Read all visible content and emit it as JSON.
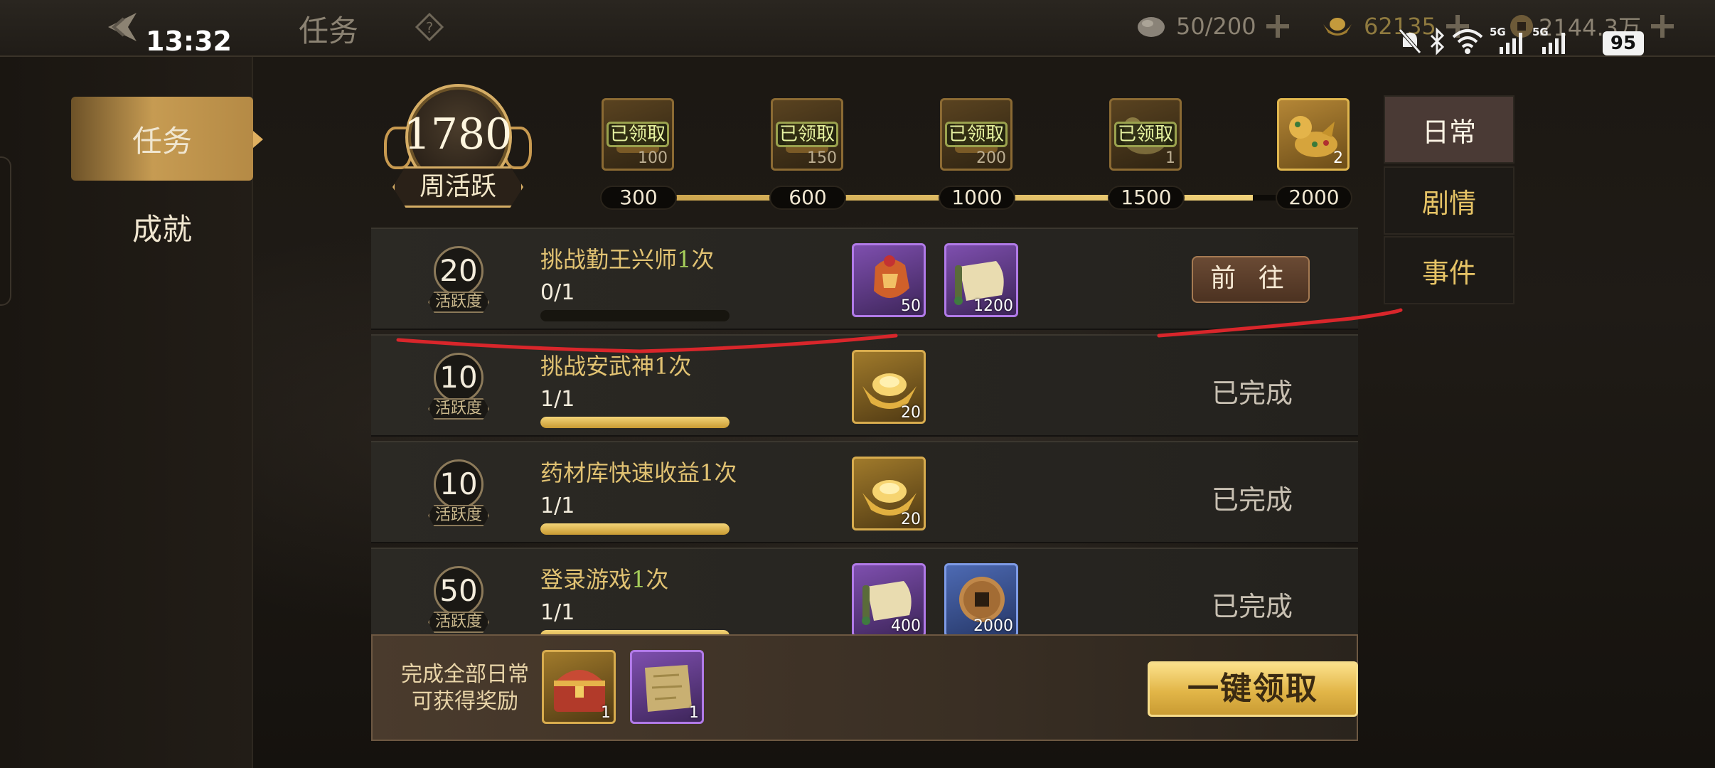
{
  "status": {
    "time": "13:32",
    "battery": "95",
    "network": [
      "5G",
      "5G"
    ]
  },
  "header": {
    "title": "任务",
    "resources": [
      {
        "icon": "stone-icon",
        "value": "50/200"
      },
      {
        "icon": "gold-ingot-icon",
        "value": "62135"
      },
      {
        "icon": "coin-icon",
        "value": "2144.3万"
      }
    ]
  },
  "nav": [
    {
      "label": "任务",
      "active": true
    },
    {
      "label": "成就",
      "active": false
    }
  ],
  "weekly": {
    "points": "1780",
    "label": "周活跃",
    "progress": 0.87,
    "milestones": [
      {
        "threshold": "300",
        "badge": "已领取",
        "count": "100"
      },
      {
        "threshold": "600",
        "badge": "已领取",
        "count": "150"
      },
      {
        "threshold": "1000",
        "badge": "已领取",
        "count": "200"
      },
      {
        "threshold": "1500",
        "badge": "已领取",
        "count": "1"
      },
      {
        "threshold": "2000",
        "badge": "",
        "count": "2"
      }
    ]
  },
  "tabs": [
    {
      "label": "日常",
      "active": true
    },
    {
      "label": "剧情",
      "active": false
    },
    {
      "label": "事件",
      "active": false
    }
  ],
  "tasks": [
    {
      "points": "20",
      "points_label": "活跃度",
      "name": "挑战勤王兴师",
      "count": "1",
      "unit": "次",
      "progress_text": "0/1",
      "progress": 0,
      "rewards": [
        {
          "icon": "token-icon",
          "frame": "purple",
          "count": "50"
        },
        {
          "icon": "scroll-icon",
          "frame": "purple",
          "count": "1200"
        }
      ],
      "action": "前 往",
      "status": ""
    },
    {
      "points": "10",
      "points_label": "活跃度",
      "name": "挑战安武神",
      "count": "1",
      "unit": "次",
      "progress_text": "1/1",
      "progress": 1,
      "rewards": [
        {
          "icon": "gold-ingot-icon",
          "frame": "gold",
          "count": "20"
        }
      ],
      "action": "",
      "status": "已完成"
    },
    {
      "points": "10",
      "points_label": "活跃度",
      "name": "药材库快速收益",
      "count": "1",
      "unit": "次",
      "progress_text": "1/1",
      "progress": 1,
      "rewards": [
        {
          "icon": "gold-ingot-icon",
          "frame": "gold",
          "count": "20"
        }
      ],
      "action": "",
      "status": "已完成"
    },
    {
      "points": "50",
      "points_label": "活跃度",
      "name": "登录游戏",
      "count": "1",
      "unit": "次",
      "progress_text": "1/1",
      "progress": 1,
      "rewards": [
        {
          "icon": "scroll-icon",
          "frame": "purple",
          "count": "400"
        },
        {
          "icon": "copper-coin-icon",
          "frame": "blue",
          "count": "2000"
        }
      ],
      "action": "",
      "status": "已完成"
    }
  ],
  "bottom": {
    "text": [
      "完成全部日常",
      "可获得奖励"
    ],
    "rewards": [
      {
        "icon": "treasure-chest-icon",
        "frame": "gold",
        "count": "1"
      },
      {
        "icon": "map-icon",
        "frame": "purple",
        "count": "1"
      }
    ],
    "claim_all": "一键领取"
  },
  "colors": {
    "accent_gold": "#e1c272",
    "progress_fill": "#f1d27a",
    "annotation_red": "#d9262b"
  }
}
